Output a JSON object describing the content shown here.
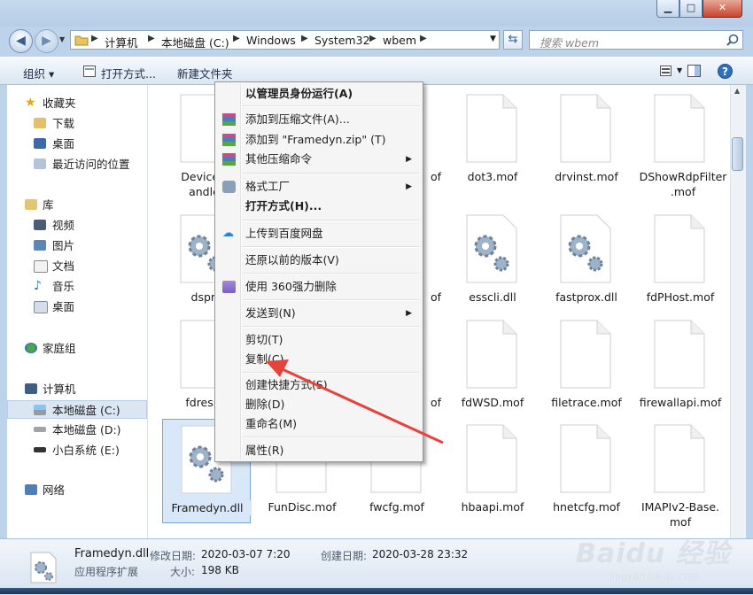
{
  "window": {
    "controls": {
      "minimize": "▁",
      "maximize": "□",
      "close": "✕"
    }
  },
  "address": {
    "crumbs": [
      "计算机",
      "本地磁盘 (C:)",
      "Windows",
      "System32",
      "wbem"
    ],
    "search_placeholder": "搜索 wbem"
  },
  "toolbar": {
    "organize": "组织",
    "open_with": "打开方式...",
    "new_folder": "新建文件夹"
  },
  "nav": {
    "favorites": "收藏夹",
    "downloads": "下载",
    "desktop": "桌面",
    "recent": "最近访问的位置",
    "libraries": "库",
    "videos": "视频",
    "pictures": "图片",
    "documents": "文档",
    "music": "音乐",
    "lib_desktop": "桌面",
    "homegroup": "家庭组",
    "computer": "计算机",
    "drive_c": "本地磁盘 (C:)",
    "drive_d": "本地磁盘 (D:)",
    "drive_e": "小白系统 (E:)",
    "network": "网络"
  },
  "files": {
    "f1": "DevicePa\nandler",
    "f2": "of",
    "f3": "dot3.mof",
    "f4": "drvinst.mof",
    "f5": "DShowRdpFilter\n.mof",
    "f6": "dspro",
    "f7": "of",
    "f8": "esscli.dll",
    "f9": "fastprox.dll",
    "f10": "fdPHost.mof",
    "f11": "fdrespu",
    "f12": "of",
    "f13": "fdWSD.mof",
    "f14": "filetrace.mof",
    "f15": "firewallapi.mof",
    "f16": "Framedyn.dll",
    "f17": "FunDisc.mof",
    "f18": "fwcfg.mof",
    "f19": "hbaapi.mof",
    "f20": "hnetcfg.mof",
    "f21": "IMAPIv2-Base.\nmof"
  },
  "menu": {
    "run_admin": "以管理员身份运行(A)",
    "add_archive": "添加到压缩文件(A)...",
    "add_zip": "添加到 \"Framedyn.zip\" (T)",
    "other_compress": "其他压缩命令",
    "format_factory": "格式工厂",
    "open_with": "打开方式(H)...",
    "upload_baidu": "上传到百度网盘",
    "restore": "还原以前的版本(V)",
    "delete_360": "使用 360强力删除",
    "send_to": "发送到(N)",
    "cut": "剪切(T)",
    "copy": "复制(C)",
    "create_shortcut": "创建快捷方式(S)",
    "delete": "删除(D)",
    "rename": "重命名(M)",
    "properties": "属性(R)"
  },
  "details": {
    "filename": "Framedyn.dll",
    "type": "应用程序扩展",
    "modified_label": "修改日期:",
    "modified": "2020-03-07 7:20",
    "size_label": "大小:",
    "size": "198 KB",
    "created_label": "创建日期:",
    "created": "2020-03-28 23:32"
  },
  "watermark": {
    "brand": "Baidu 经验",
    "url": "jingyan.baidu.com"
  },
  "colors": {
    "selection": "#d9e8f8",
    "arrow": "#e8433a",
    "window_frame": "#bcd3ea"
  }
}
